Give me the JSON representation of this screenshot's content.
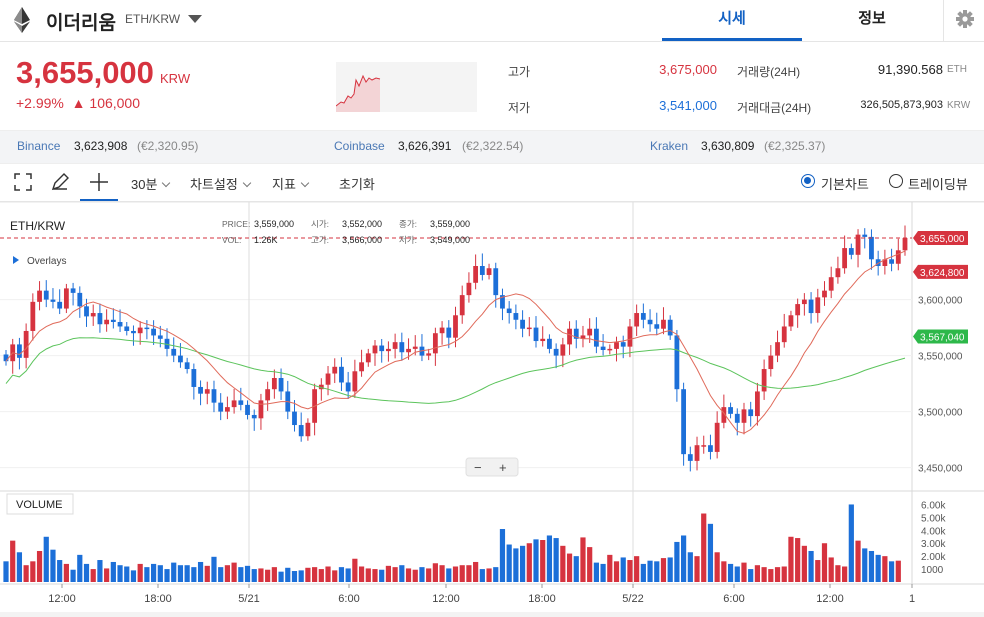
{
  "header": {
    "coin_name": "이더리움",
    "pair": "ETH/KRW",
    "tabs": [
      "시세",
      "정보"
    ],
    "active_tab": "시세"
  },
  "ticker": {
    "price": "3,655,000",
    "unit": "KRW",
    "change_pct": "+2.99%",
    "change_abs": "▲ 106,000"
  },
  "stats": {
    "high_label": "고가",
    "high": "3,675,000",
    "low_label": "저가",
    "low": "3,541,000",
    "vol_label": "거래량(24H)",
    "vol": "91,390.568",
    "vol_unit": "ETH",
    "amt_label": "거래대금(24H)",
    "amt": "326,505,873,903",
    "amt_unit": "KRW"
  },
  "exchanges": [
    {
      "name": "Binance",
      "price": "3,623,908",
      "eur": "(€2,320.95)"
    },
    {
      "name": "Coinbase",
      "price": "3,626,391",
      "eur": "(€2,322.54)"
    },
    {
      "name": "Kraken",
      "price": "3,630,809",
      "eur": "(€2,325.37)"
    }
  ],
  "toolbar": {
    "interval": "30분",
    "settings": "차트설정",
    "indicators": "지표",
    "reset": "초기화",
    "basic_chart": "기본차트",
    "trading_view": "트레이딩뷰",
    "selected_view": "기본차트"
  },
  "chart_data": {
    "type": "candlestick",
    "symbol": "ETH/KRW",
    "ohlc_header": {
      "PRICE": "3,559,000",
      "시가": "3,552,000",
      "종가": "3,559,000",
      "VOL": "1.26K",
      "고가": "3,566,000",
      "저가": "3,549,000"
    },
    "overlays_label": "Overlays",
    "price_axis": {
      "ticks": [
        3600000,
        3550000,
        3500000,
        3450000
      ],
      "range": [
        3430000,
        3680000
      ]
    },
    "price_tick_labels": [
      "3,600,000",
      "3,550,000",
      "3,500,000",
      "3,450,000"
    ],
    "badges": [
      {
        "value": 3655000,
        "label": "3,655,000",
        "color": "#d6333f"
      },
      {
        "value": 3624800,
        "label": "3,624,800",
        "color": "#d6333f"
      },
      {
        "value": 3567040,
        "label": "3,567,040",
        "color": "#2db84a"
      }
    ],
    "volume_label": "VOLUME",
    "volume_axis": {
      "ticks": [
        6000,
        5000,
        4000,
        3000,
        2000,
        1000
      ],
      "labels": [
        "6.00k",
        "5.00k",
        "4.00k",
        "3.00k",
        "2.00k",
        "1000"
      ],
      "range": [
        0,
        6500
      ]
    },
    "x_labels": [
      "12:00",
      "18:00",
      "5/21",
      "6:00",
      "12:00",
      "18:00",
      "5/22",
      "6:00",
      "12:00",
      "1"
    ],
    "colors": {
      "up": "#d6333f",
      "down": "#1c6fd8",
      "ma_short": "#e06a5a",
      "ma_long": "#5cc45c"
    },
    "zoom_controls": [
      "−",
      "+"
    ],
    "close": [
      3545000,
      3560000,
      3548000,
      3572000,
      3598000,
      3608000,
      3600000,
      3598000,
      3592000,
      3610000,
      3606000,
      3594000,
      3585000,
      3588000,
      3578000,
      3582000,
      3580000,
      3576000,
      3572000,
      3570000,
      3575000,
      3574000,
      3568000,
      3565000,
      3556000,
      3550000,
      3544000,
      3538000,
      3522000,
      3516000,
      3520000,
      3508000,
      3500000,
      3504000,
      3510000,
      3506000,
      3497000,
      3494000,
      3510000,
      3520000,
      3530000,
      3518000,
      3500000,
      3488000,
      3478000,
      3490000,
      3520000,
      3524000,
      3534000,
      3540000,
      3526000,
      3518000,
      3536000,
      3544000,
      3552000,
      3559000,
      3554000,
      3556000,
      3562000,
      3553000,
      3556000,
      3558000,
      3550000,
      3552000,
      3570000,
      3575000,
      3566000,
      3586000,
      3604000,
      3615000,
      3630000,
      3622000,
      3628000,
      3604000,
      3592000,
      3588000,
      3582000,
      3574000,
      3575000,
      3563000,
      3565000,
      3556000,
      3550000,
      3560000,
      3574000,
      3565000,
      3568000,
      3574000,
      3558000,
      3555000,
      3556000,
      3562000,
      3558000,
      3576000,
      3588000,
      3582000,
      3578000,
      3574000,
      3582000,
      3568000,
      3520000,
      3462000,
      3456000,
      3470000,
      3470000,
      3464000,
      3490000,
      3504000,
      3498000,
      3490000,
      3502000,
      3496000,
      3518000,
      3538000,
      3550000,
      3562000,
      3576000,
      3586000,
      3596000,
      3600000,
      3588000,
      3602000,
      3608000,
      3620000,
      3628000,
      3646000,
      3640000,
      3658000,
      3656000,
      3636000,
      3630000,
      3636000,
      3632000,
      3644000,
      3655000
    ],
    "volume": [
      1600,
      3200,
      2300,
      1300,
      1600,
      2400,
      3500,
      2500,
      1700,
      1400,
      950,
      2100,
      1400,
      1000,
      1700,
      1050,
      1550,
      1300,
      1200,
      900,
      1400,
      1150,
      1400,
      1300,
      1000,
      1500,
      1300,
      1300,
      1150,
      1550,
      1250,
      1950,
      1150,
      1300,
      1500,
      1150,
      1250,
      1000,
      1050,
      950,
      1150,
      800,
      1100,
      850,
      900,
      1100,
      1150,
      1000,
      1200,
      900,
      1150,
      1050,
      1800,
      1200,
      1050,
      1000,
      950,
      1250,
      1150,
      1300,
      1050,
      950,
      1150,
      1050,
      1450,
      1300,
      1050,
      1200,
      1300,
      1300,
      1550,
      1000,
      1050,
      1150,
      4100,
      2900,
      2600,
      2800,
      3000,
      3300,
      3250,
      3600,
      3400,
      2800,
      2200,
      2000,
      3450,
      2700,
      1500,
      1400,
      2100,
      1600,
      1900,
      1700,
      2000,
      1400,
      1650,
      1600,
      1850,
      1900,
      3100,
      3600,
      2300,
      2000,
      5300,
      4500,
      2300,
      1600,
      1400,
      1200,
      1500,
      1000,
      1300,
      1150,
      1000,
      1150,
      1200,
      3500,
      3400,
      2800,
      2400,
      1700,
      3000,
      1900,
      1300,
      1200,
      6000,
      3200,
      2600,
      2400,
      2100,
      2000,
      1600,
      1650
    ]
  }
}
